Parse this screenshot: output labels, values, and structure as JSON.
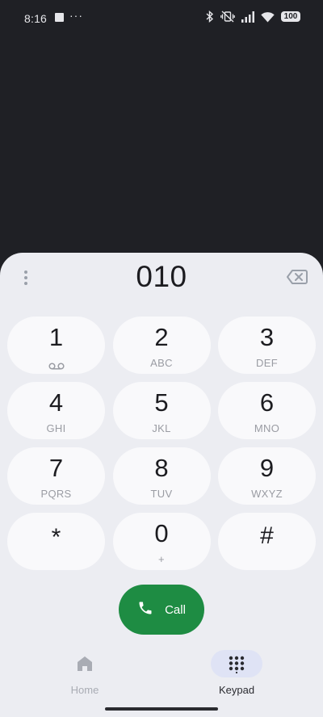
{
  "status_bar": {
    "time": "8:16",
    "dots": "···",
    "battery": "100",
    "icons": [
      "notification-square-icon",
      "bluetooth-icon",
      "vibrate-icon",
      "signal-icon",
      "wifi-icon",
      "battery-icon"
    ]
  },
  "dialer": {
    "dialed_number": "010",
    "icons": [
      "more-vert-icon",
      "backspace-icon"
    ],
    "keys": [
      {
        "digit": "1",
        "sub": "",
        "icon": "voicemail-icon"
      },
      {
        "digit": "2",
        "sub": "ABC"
      },
      {
        "digit": "3",
        "sub": "DEF"
      },
      {
        "digit": "4",
        "sub": "GHI"
      },
      {
        "digit": "5",
        "sub": "JKL"
      },
      {
        "digit": "6",
        "sub": "MNO"
      },
      {
        "digit": "7",
        "sub": "PQRS"
      },
      {
        "digit": "8",
        "sub": "TUV"
      },
      {
        "digit": "9",
        "sub": "WXYZ"
      },
      {
        "digit": "*",
        "sub": ""
      },
      {
        "digit": "0",
        "sub": "+"
      },
      {
        "digit": "#",
        "sub": ""
      }
    ],
    "call_label": "Call"
  },
  "nav": {
    "home_label": "Home",
    "keypad_label": "Keypad",
    "selected": "Keypad"
  },
  "colors": {
    "background": "#1f2025",
    "sheet": "#ecedf2",
    "key": "#f9f9fb",
    "call_green": "#1e8c43",
    "nav_selected_pill": "#dfe3f5"
  }
}
